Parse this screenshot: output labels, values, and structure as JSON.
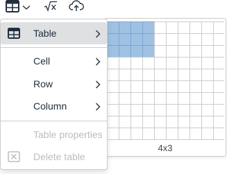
{
  "toolbar": {
    "items": [
      {
        "icon": "table-icon",
        "has_dropdown": true
      },
      {
        "icon": "math-equation-icon",
        "has_dropdown": false
      },
      {
        "icon": "cloud-upload-icon",
        "has_dropdown": false
      }
    ]
  },
  "table_menu": {
    "items": [
      {
        "label": "Table",
        "icon": "table-icon",
        "submenu": true,
        "active": true,
        "disabled": false
      },
      {
        "label": "Cell",
        "icon": null,
        "submenu": true,
        "active": false,
        "disabled": false
      },
      {
        "label": "Row",
        "icon": null,
        "submenu": true,
        "active": false,
        "disabled": false
      },
      {
        "label": "Column",
        "icon": null,
        "submenu": true,
        "active": false,
        "disabled": false
      },
      {
        "label": "Table properties",
        "icon": null,
        "submenu": false,
        "active": false,
        "disabled": true
      },
      {
        "label": "Delete table",
        "icon": "delete-table-icon",
        "submenu": false,
        "active": false,
        "disabled": true
      }
    ]
  },
  "grid_picker": {
    "columns": 10,
    "rows": 10,
    "selected_columns": 4,
    "selected_rows": 3,
    "size_label": "4x3",
    "colors": {
      "selected_fill": "#9fc2e3",
      "selected_border": "#7ba5d0",
      "cell_border": "#cccccc"
    }
  },
  "colors": {
    "active_item_bg": "#dee0e2",
    "disabled_text": "#b9bdc1",
    "text": "#222f3e"
  }
}
